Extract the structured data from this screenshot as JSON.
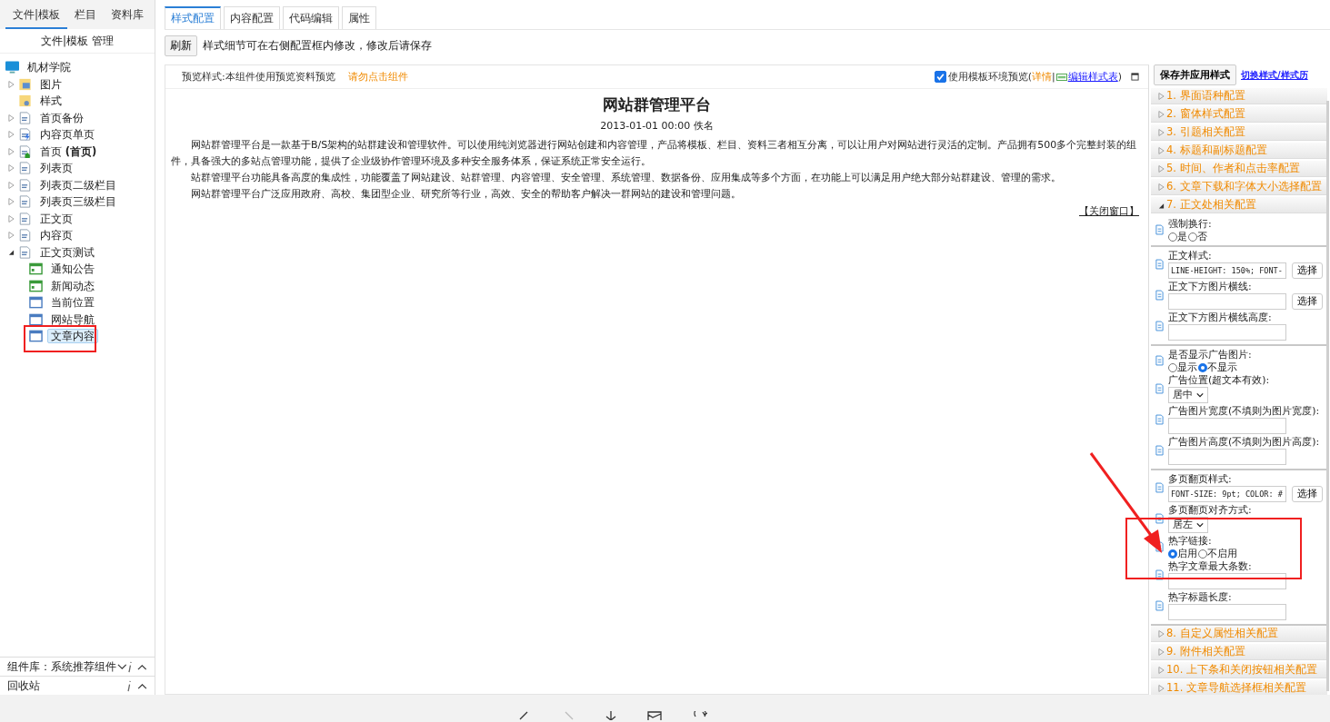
{
  "sidebar": {
    "tabs": [
      {
        "label": "文件|模板",
        "selected": true
      },
      {
        "label": "栏目",
        "selected": false
      },
      {
        "label": "资料库",
        "selected": false
      }
    ],
    "title": "文件|模板 管理",
    "tree": {
      "label": "机材学院",
      "kind": "site",
      "selected": false,
      "children": [
        {
          "label": "图片",
          "kind": "image-folder",
          "expanded": false,
          "selected": false
        },
        {
          "label": "样式",
          "kind": "style-folder",
          "selected": false
        },
        {
          "label": "首页备份",
          "kind": "page",
          "expanded": false,
          "selected": false
        },
        {
          "label": "内容页单页",
          "kind": "page-lightning",
          "expanded": false,
          "selected": false
        },
        {
          "label": "首页 **(首页)**",
          "kind": "page-home",
          "expanded": false,
          "selected": false
        },
        {
          "label": "列表页",
          "kind": "page",
          "expanded": false,
          "selected": false
        },
        {
          "label": "列表页二级栏目",
          "kind": "page",
          "expanded": false,
          "selected": false
        },
        {
          "label": "列表页三级栏目",
          "kind": "page",
          "expanded": false,
          "selected": false
        },
        {
          "label": "正文页",
          "kind": "page",
          "expanded": false,
          "selected": false
        },
        {
          "label": "内容页",
          "kind": "page",
          "expanded": false,
          "selected": false
        },
        {
          "label": "正文页测试",
          "kind": "page",
          "expanded": true,
          "selected": false,
          "children": [
            {
              "label": "通知公告",
              "kind": "list-widget",
              "selected": false
            },
            {
              "label": "新闻动态",
              "kind": "list-widget",
              "selected": false
            },
            {
              "label": "当前位置",
              "kind": "widget",
              "selected": false
            },
            {
              "label": "网站导航",
              "kind": "widget",
              "selected": false
            },
            {
              "label": "文章内容",
              "kind": "widget",
              "selected": true
            }
          ]
        }
      ]
    },
    "panels": [
      {
        "label": "组件库：系统推荐组件",
        "dropdown": true
      },
      {
        "label": "回收站",
        "dropdown": false
      }
    ]
  },
  "tabs": [
    {
      "label": "样式配置",
      "selected": true
    },
    {
      "label": "内容配置",
      "selected": false
    },
    {
      "label": "代码编辑",
      "selected": false
    },
    {
      "label": "属性",
      "selected": false
    }
  ],
  "toolbar": {
    "refresh": "刷新",
    "hint": "样式细节可在右侧配置框内修改，修改后请保存"
  },
  "preview": {
    "label": "预览样式:本组件使用预览资料预览",
    "warning": "请勿点击组件",
    "env_checkbox": {
      "label": "使用模板环境预览",
      "checked": true
    },
    "paren_open": "(",
    "details_link": "详情",
    "separator": "|",
    "edit_link": "编辑样式表",
    "paren_close": ")",
    "article": {
      "title": "网站群管理平台",
      "meta": "2013-01-01 00:00 佚名",
      "paragraphs": [
        "网站群管理平台是一款基于B/S架构的站群建设和管理软件。可以使用纯浏览器进行网站创建和内容管理，产品将模板、栏目、资料三者相互分离，可以让用户对网站进行灵活的定制。产品拥有500多个完整封装的组件，具备强大的多站点管理功能，提供了企业级协作管理环境及多种安全服务体系，保证系统正常安全运行。",
        "站群管理平台功能具备高度的集成性，功能覆盖了网站建设、站群管理、内容管理、安全管理、系统管理、数据备份、应用集成等多个方面，在功能上可以满足用户绝大部分站群建设、管理的需求。",
        "网站群管理平台广泛应用政府、高校、集团型企业、研究所等行业，高效、安全的帮助客户解决一群网站的建设和管理问题。"
      ],
      "close_link": "【关闭窗口】"
    }
  },
  "config": {
    "save_button": "保存并应用样式",
    "switch_link": "切换样式/样式历",
    "sections": [
      {
        "label": "1.  界面语种配置",
        "expanded": false
      },
      {
        "label": "2.  窗体样式配置",
        "expanded": false
      },
      {
        "label": "3.  引题相关配置",
        "expanded": false
      },
      {
        "label": "4.  标题和副标题配置",
        "expanded": false
      },
      {
        "label": "5.  时间、作者和点击率配置",
        "expanded": false
      },
      {
        "label": "6.  文章下载和字体大小选择配置",
        "expanded": false
      },
      {
        "label": "7.  正文处相关配置",
        "expanded": true,
        "groups": [
          [
            {
              "kind": "radio",
              "label": "强制换行:",
              "options": [
                {
                  "label": "是",
                  "selected": false
                },
                {
                  "label": "否",
                  "selected": false
                }
              ]
            }
          ],
          [
            {
              "kind": "text",
              "label": "正文样式:",
              "value": "LINE-HEIGHT: 150%; FONT-",
              "button": "选择"
            },
            {
              "kind": "text",
              "label": "正文下方图片横线:",
              "button": "选择"
            },
            {
              "kind": "text",
              "label": "正文下方图片横线高度:"
            }
          ],
          [
            {
              "kind": "radio",
              "label": "是否显示广告图片:",
              "options": [
                {
                  "label": "显示",
                  "selected": false
                },
                {
                  "label": "不显示",
                  "selected": true
                }
              ]
            },
            {
              "kind": "select",
              "label": "广告位置(超文本有效):",
              "value": "居中"
            },
            {
              "kind": "text",
              "label": "广告图片宽度(不填则为图片宽度):"
            },
            {
              "kind": "text",
              "label": "广告图片高度(不填则为图片高度):"
            }
          ],
          [
            {
              "kind": "text",
              "label": "多页翻页样式:",
              "value": "FONT-SIZE: 9pt; COLOR: #",
              "button": "选择"
            },
            {
              "kind": "select",
              "label": "多页翻页对齐方式:",
              "value": "居左"
            },
            {
              "kind": "radio",
              "label": "热字链接:",
              "options": [
                {
                  "label": "启用",
                  "selected": true
                },
                {
                  "label": "不启用",
                  "selected": false
                }
              ]
            },
            {
              "kind": "text",
              "label": "热字文章最大条数:"
            },
            {
              "kind": "text",
              "label": "热字标题长度:"
            }
          ]
        ]
      },
      {
        "label": "8.  自定义属性相关配置",
        "expanded": false
      },
      {
        "label": "9.  附件相关配置",
        "expanded": false
      },
      {
        "label": "10.  上下条和关闭按钮相关配置",
        "expanded": false
      },
      {
        "label": "11.  文章导航选择框相关配置",
        "expanded": false
      }
    ]
  }
}
